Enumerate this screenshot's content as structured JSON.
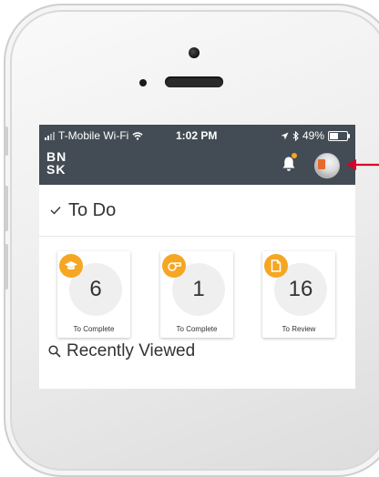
{
  "status_bar": {
    "carrier": "T-Mobile Wi-Fi",
    "time": "1:02 PM",
    "battery": "49%"
  },
  "app_bar": {
    "logo_line1": "BN",
    "logo_line2": "SK",
    "notification_dot_color": "#f5a623"
  },
  "todo": {
    "title": "To Do",
    "cards": [
      {
        "icon": "graduation-cap-icon",
        "count": "6",
        "label": "To Complete"
      },
      {
        "icon": "whistle-icon",
        "count": "1",
        "label": "To Complete"
      },
      {
        "icon": "document-icon",
        "count": "16",
        "label": "To Review"
      }
    ]
  },
  "recently_viewed": {
    "title": "Recently Viewed"
  },
  "colors": {
    "header_bg": "#434c54",
    "accent": "#f5a623",
    "annotation_arrow": "#d9002b"
  }
}
